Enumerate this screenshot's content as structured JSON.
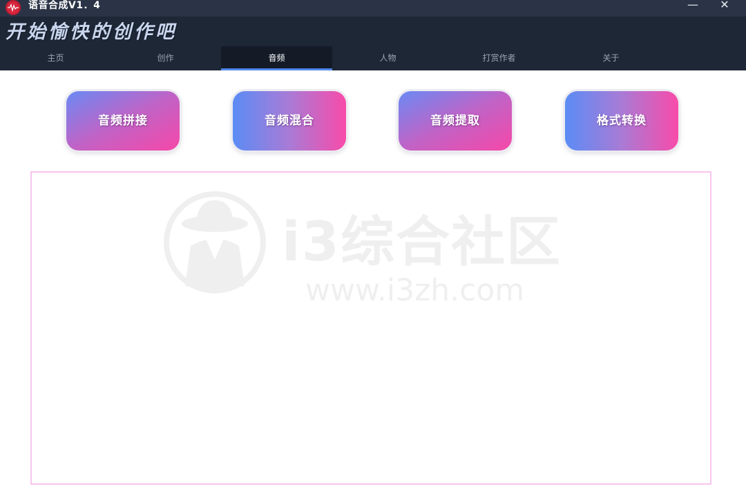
{
  "window": {
    "title": "语音合成V1．4",
    "min_symbol": "—",
    "close_symbol": "✕"
  },
  "header": {
    "slogan": "开始愉快的创作吧"
  },
  "tabs": [
    {
      "label": "主页",
      "active": false
    },
    {
      "label": "创作",
      "active": false
    },
    {
      "label": "音频",
      "active": true
    },
    {
      "label": "人物",
      "active": false
    },
    {
      "label": "打赏作者",
      "active": false
    },
    {
      "label": "关于",
      "active": false
    }
  ],
  "actions": [
    {
      "label": "音频拼接"
    },
    {
      "label": "音频混合"
    },
    {
      "label": "音频提取"
    },
    {
      "label": "格式转换"
    }
  ],
  "watermark": {
    "name": "i3综合社区",
    "url": "www.i3zh.com"
  },
  "colors": {
    "titlebar": "#2a3446",
    "header": "#1e2736",
    "active_tab_underline": "#4d87f0",
    "content_border": "#f7c4ee",
    "gradient_blue": "#5b8cf5",
    "gradient_pink": "#f84ba9"
  }
}
